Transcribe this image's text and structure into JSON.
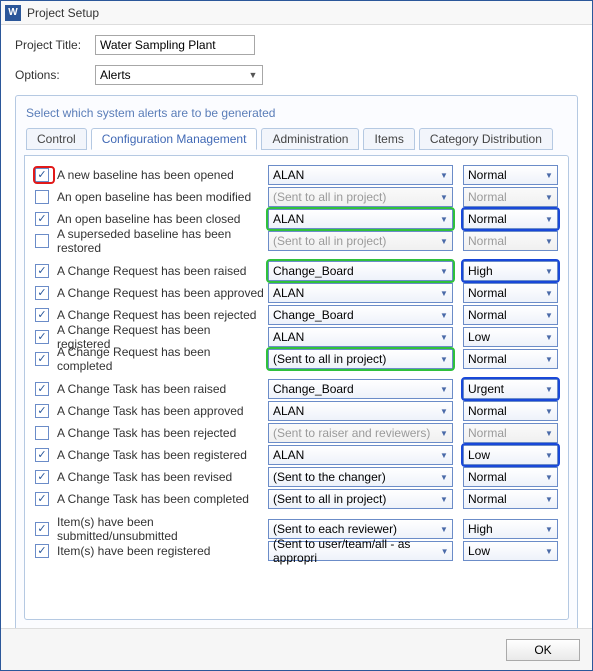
{
  "window": {
    "appLetter": "W",
    "title": "Project Setup"
  },
  "fields": {
    "projectTitleLabel": "Project Title:",
    "projectTitleValue": "Water Sampling Plant",
    "optionsLabel": "Options:",
    "optionsValue": "Alerts"
  },
  "panel": {
    "caption": "Select which system alerts are to be generated"
  },
  "tabs": {
    "control": "Control",
    "config": "Configuration Management",
    "admin": "Administration",
    "items": "Items",
    "catdist": "Category Distribution"
  },
  "alerts": [
    {
      "checked": true,
      "label": "A new baseline has been opened",
      "recipient": "ALAN",
      "priority": "Normal",
      "disabled": false,
      "chkHl": "red"
    },
    {
      "checked": false,
      "label": "An open baseline has been modified",
      "recipient": "(Sent to all in project)",
      "priority": "Normal",
      "disabled": true
    },
    {
      "checked": true,
      "label": "An open baseline has been closed",
      "recipient": "ALAN",
      "priority": "Normal",
      "disabled": false,
      "recipHl": "green",
      "prioHl": "blue"
    },
    {
      "checked": false,
      "label": "A superseded baseline has been restored",
      "recipient": "(Sent to all in project)",
      "priority": "Normal",
      "disabled": true
    },
    {
      "spacer": true
    },
    {
      "checked": true,
      "label": "A Change Request has been raised",
      "recipient": "Change_Board",
      "priority": "High",
      "disabled": false,
      "recipHl": "green",
      "prioHl": "blue"
    },
    {
      "checked": true,
      "label": "A Change Request has been approved",
      "recipient": "ALAN",
      "priority": "Normal",
      "disabled": false
    },
    {
      "checked": true,
      "label": "A Change Request has been rejected",
      "recipient": "Change_Board",
      "priority": "Normal",
      "disabled": false
    },
    {
      "checked": true,
      "label": "A Change Request has been registered",
      "recipient": "ALAN",
      "priority": "Low",
      "disabled": false
    },
    {
      "checked": true,
      "label": "A Change Request has been completed",
      "recipient": "(Sent to all in project)",
      "priority": "Normal",
      "disabled": false,
      "recipHl": "green"
    },
    {
      "spacer": true
    },
    {
      "checked": true,
      "label": "A Change Task has been raised",
      "recipient": "Change_Board",
      "priority": "Urgent",
      "disabled": false,
      "prioHl": "blue"
    },
    {
      "checked": true,
      "label": "A Change Task has been approved",
      "recipient": "ALAN",
      "priority": "Normal",
      "disabled": false
    },
    {
      "checked": false,
      "label": "A Change Task has been rejected",
      "recipient": "(Sent to raiser and reviewers)",
      "priority": "Normal",
      "disabled": true
    },
    {
      "checked": true,
      "label": "A Change Task has been registered",
      "recipient": "ALAN",
      "priority": "Low",
      "disabled": false,
      "prioHl": "blue"
    },
    {
      "checked": true,
      "label": "A Change Task has been revised",
      "recipient": "(Sent to the changer)",
      "priority": "Normal",
      "disabled": false
    },
    {
      "checked": true,
      "label": "A Change Task has been completed",
      "recipient": "(Sent to all in project)",
      "priority": "Normal",
      "disabled": false
    },
    {
      "spacer": true
    },
    {
      "checked": true,
      "label": "Item(s) have been submitted/unsubmitted",
      "recipient": "(Sent to each reviewer)",
      "priority": "High",
      "disabled": false
    },
    {
      "checked": true,
      "label": "Item(s) have been registered",
      "recipient": "(Sent to user/team/all - as appropri",
      "priority": "Low",
      "disabled": false
    }
  ],
  "footer": {
    "ok": "OK"
  }
}
